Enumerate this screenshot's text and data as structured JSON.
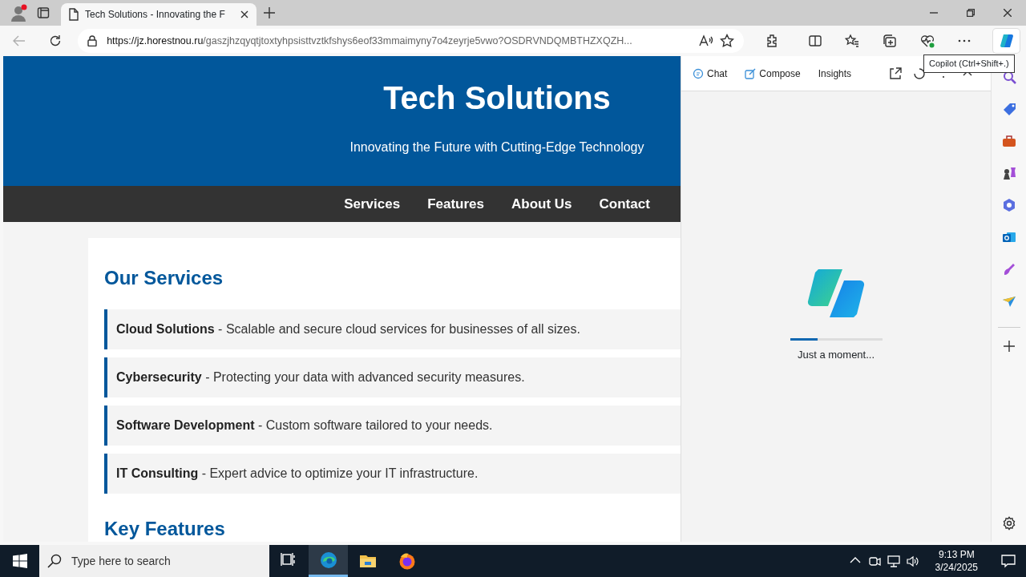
{
  "browser": {
    "tabs": [
      {
        "title": "Tech Solutions - Innovating the F",
        "selected": true
      }
    ],
    "back_disabled": true,
    "url": {
      "host": "https://jz.horestnou.ru",
      "path": "/gaszjhzqyqtjtoxtyhpsisttvztkfshys6eof33mmaimyny7o4zeyrje5vwo?OSDRVNDQMBTHZXQZH..."
    },
    "copilot_active": true,
    "tooltip": "Copilot (Ctrl+Shift+.)"
  },
  "page": {
    "title": "Tech Solutions",
    "tagline": "Innovating the Future with Cutting-Edge Technology",
    "nav": [
      "Services",
      "Features",
      "About Us",
      "Contact"
    ],
    "services_heading": "Our Services",
    "services": [
      {
        "name": "Cloud Solutions",
        "desc": " - Scalable and secure cloud services for businesses of all sizes."
      },
      {
        "name": "Cybersecurity",
        "desc": " - Protecting your data with advanced security measures."
      },
      {
        "name": "Software Development",
        "desc": " - Custom software tailored to your needs."
      },
      {
        "name": "IT Consulting",
        "desc": " - Expert advice to optimize your IT infrastructure."
      }
    ],
    "features_heading": "Key Features"
  },
  "copilot": {
    "tabs": [
      {
        "label": "Chat",
        "kind": "chat"
      },
      {
        "label": "Compose",
        "kind": "compose"
      },
      {
        "label": "Insights",
        "kind": "plain"
      }
    ],
    "loading": {
      "level": 0.3,
      "text": "Just a moment..."
    }
  },
  "taskbar": {
    "search_placeholder": "Type here to search",
    "apps": [
      {
        "kind": "taskview",
        "active": false
      },
      {
        "kind": "edge",
        "active": true
      },
      {
        "kind": "files",
        "active": false
      },
      {
        "kind": "firefox",
        "active": false
      }
    ],
    "time": "9:13 PM",
    "date": "3/24/2025"
  }
}
